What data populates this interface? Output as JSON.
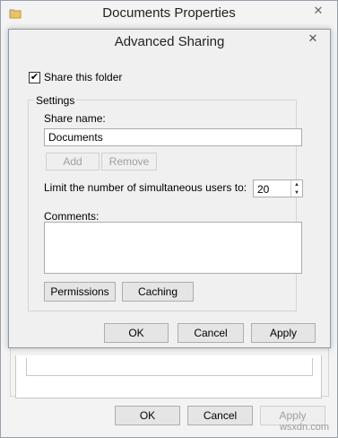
{
  "outer_window": {
    "title": "Documents Properties",
    "close_glyph": "✕",
    "folder_icon": "folder-icon",
    "buttons": {
      "ok": "OK",
      "cancel": "Cancel",
      "apply": "Apply"
    }
  },
  "dialog": {
    "title": "Advanced Sharing",
    "close_glyph": "✕",
    "share_checkbox": {
      "label": "Share this folder",
      "checked": true,
      "mark": "✔"
    },
    "settings": {
      "group_label": "Settings",
      "share_name_label": "Share name:",
      "share_name_value": "Documents",
      "add_label": "Add",
      "remove_label": "Remove",
      "limit_label": "Limit the number of simultaneous users to:",
      "limit_value": "20",
      "comments_label": "Comments:",
      "comments_value": "",
      "permissions_label": "Permissions",
      "caching_label": "Caching"
    },
    "buttons": {
      "ok": "OK",
      "cancel": "Cancel",
      "apply": "Apply"
    }
  },
  "watermark": "wsxdn.com",
  "colors": {
    "dialog_bg": "#f0f0f0",
    "border": "#acacac",
    "disabled_text": "#a0a0a0"
  }
}
